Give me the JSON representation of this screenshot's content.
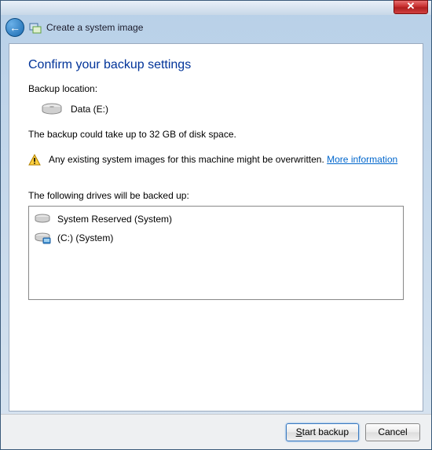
{
  "window": {
    "title": "Create a system image"
  },
  "main": {
    "heading": "Confirm your backup settings",
    "location_label": "Backup location:",
    "location_value": "Data (E:)",
    "size_text": "The backup could take up to 32 GB of disk space.",
    "warning_text": "Any existing system images for this machine might be overwritten. ",
    "more_info_link": "More information",
    "drives_label": "The following drives will be backed up:",
    "drives": [
      {
        "label": "System Reserved (System)",
        "icon": "drive-icon"
      },
      {
        "label": "(C:) (System)",
        "icon": "drive-system-icon"
      }
    ]
  },
  "footer": {
    "start_label": "Start backup",
    "start_key": "S",
    "start_rest": "tart backup",
    "cancel_label": "Cancel"
  }
}
